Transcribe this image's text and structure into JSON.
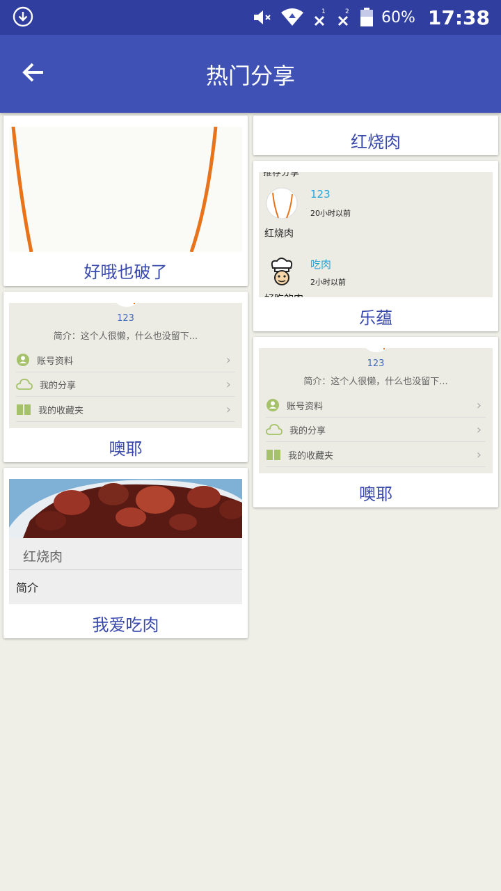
{
  "status_bar": {
    "battery_text": "60%",
    "time": "17:38",
    "icons": [
      "download-icon",
      "volume-muted-icon",
      "wifi-icon",
      "sim1-no-signal-icon",
      "sim2-no-signal-icon",
      "battery-icon"
    ]
  },
  "app_bar": {
    "title": "热门分享",
    "back_icon": "arrow-back-icon"
  },
  "colors": {
    "primary": "#3f51b5",
    "primary_dark": "#303f9f",
    "caption": "#3949ab",
    "background": "#efefe8"
  },
  "cards": {
    "c1": {
      "caption": "好哦也破了"
    },
    "c2": {
      "caption": "红烧肉"
    },
    "c3": {
      "caption": "乐蕴",
      "thumb": {
        "header_text": "推荐分享",
        "items": [
          {
            "name": "123",
            "time": "20小时以前",
            "title": "红烧肉"
          },
          {
            "name": "吃肉",
            "time": "2小时以前",
            "title": "好吃的肉"
          }
        ]
      }
    },
    "c4": {
      "caption": "噢耶",
      "thumb": {
        "name": "123",
        "bio": "简介：这个人很懒，什么也没留下...",
        "menu": [
          "账号资料",
          "我的分享",
          "我的收藏夹"
        ]
      }
    },
    "c5": {
      "caption": "噢耶",
      "thumb": {
        "name": "123",
        "bio": "简介：这个人很懒，什么也没留下...",
        "menu": [
          "账号资料",
          "我的分享",
          "我的收藏夹"
        ]
      }
    },
    "c6": {
      "caption": "我爱吃肉",
      "thumb": {
        "dish_title": "红烧肉",
        "section_label": "简介"
      }
    }
  }
}
